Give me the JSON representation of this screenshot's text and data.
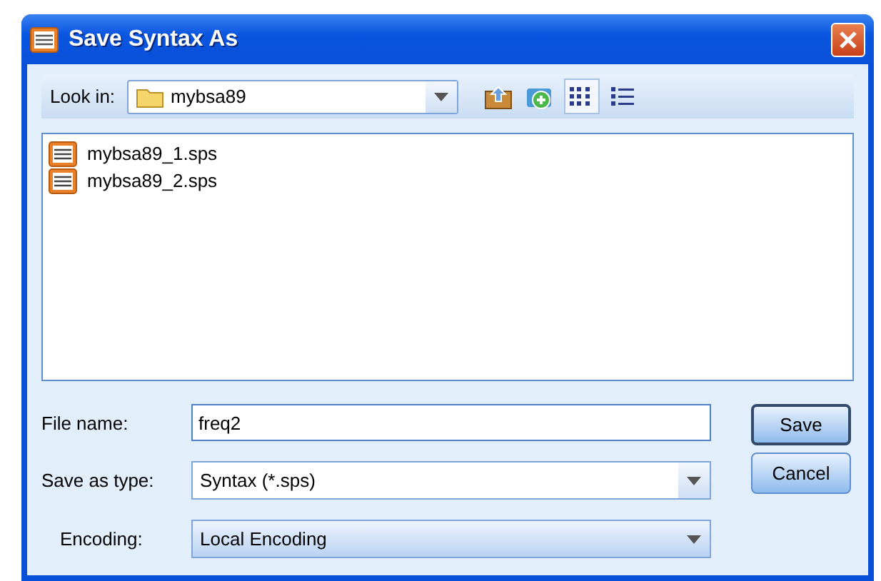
{
  "window": {
    "title": "Save Syntax As"
  },
  "look_in": {
    "label": "Look in:",
    "value": "mybsa89"
  },
  "toolbar": [
    {
      "kind": "up",
      "selected": false
    },
    {
      "kind": "new-folder",
      "selected": false
    },
    {
      "kind": "list",
      "selected": true
    },
    {
      "kind": "details",
      "selected": false
    }
  ],
  "files": [
    {
      "name": "mybsa89_1.sps"
    },
    {
      "name": "mybsa89_2.sps"
    }
  ],
  "fields": [
    {
      "kind": "text",
      "label": "File name:",
      "value": "freq2"
    },
    {
      "kind": "dropdown",
      "label": "Save as type:",
      "value": "Syntax (*.sps)"
    },
    {
      "kind": "dropdown-shaded",
      "label": "Encoding:",
      "value": "Local Encoding"
    }
  ],
  "buttons": [
    {
      "label": "Save",
      "default": true
    },
    {
      "label": "Cancel",
      "default": false
    }
  ]
}
